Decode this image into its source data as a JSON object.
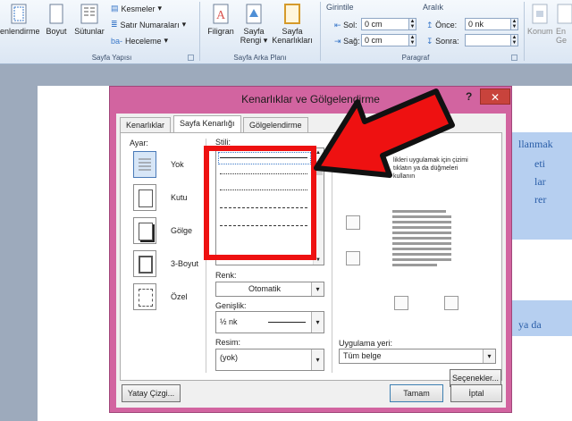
{
  "ribbon": {
    "groups": {
      "page_setup": "Sayfa Yapısı",
      "page_background": "Sayfa Arka Planı",
      "paragraph": "Paragraf"
    },
    "buttons": {
      "margins": "enlendirme",
      "size": "Boyut",
      "columns": "Sütunlar",
      "breaks": "Kesmeler",
      "line_numbers": "Satır Numaraları",
      "hyphenation": "Heceleme",
      "watermark": "Filigran",
      "page_color_1": "Sayfa",
      "page_color_2": "Rengi",
      "page_borders_1": "Sayfa",
      "page_borders_2": "Kenarlıkları",
      "position": "Konum",
      "wrap_1": "En",
      "wrap_2": "Ge"
    },
    "indent": {
      "label": "Girintile",
      "left_label": "Sol:",
      "left_value": "0 cm",
      "right_label": "Sağ:",
      "right_value": "0 cm"
    },
    "spacing": {
      "label": "Aralık",
      "before_label": "Önce:",
      "before_value": "0 nk",
      "after_label": "Sonra:",
      "after_value": ""
    }
  },
  "document": {
    "right_fragments": [
      "llanmak",
      "eti",
      "lar",
      "rer",
      "ya da"
    ]
  },
  "dialog": {
    "title": "Kenarlıklar ve Gölgelendirme",
    "help": "?",
    "close": "✕",
    "tabs": [
      "Kenarlıklar",
      "Sayfa Kenarlığı",
      "Gölgelendirme"
    ],
    "setting_label": "Ayar:",
    "settings": [
      "Yok",
      "Kutu",
      "Gölge",
      "3-Boyut",
      "Özel"
    ],
    "style_label": "Stili:",
    "color_label": "Renk:",
    "color_value": "Otomatik",
    "width_label": "Genişlik:",
    "width_value": "½ nk",
    "art_label": "Resim:",
    "art_value": "(yok)",
    "preview_text": "likleri uygulamak için çizimi tıklatın ya da düğmeleri kullanın",
    "apply_label": "Uygulama yeri:",
    "apply_value": "Tüm belge",
    "options_button": "Seçenekler...",
    "horizontal_line_button": "Yatay Çizgi...",
    "ok_button": "Tamam",
    "cancel_button": "İptal"
  },
  "colors": {
    "highlight_box": "#ee1111",
    "arrow": "#ee1111",
    "dialog_frame": "#d264a0"
  }
}
